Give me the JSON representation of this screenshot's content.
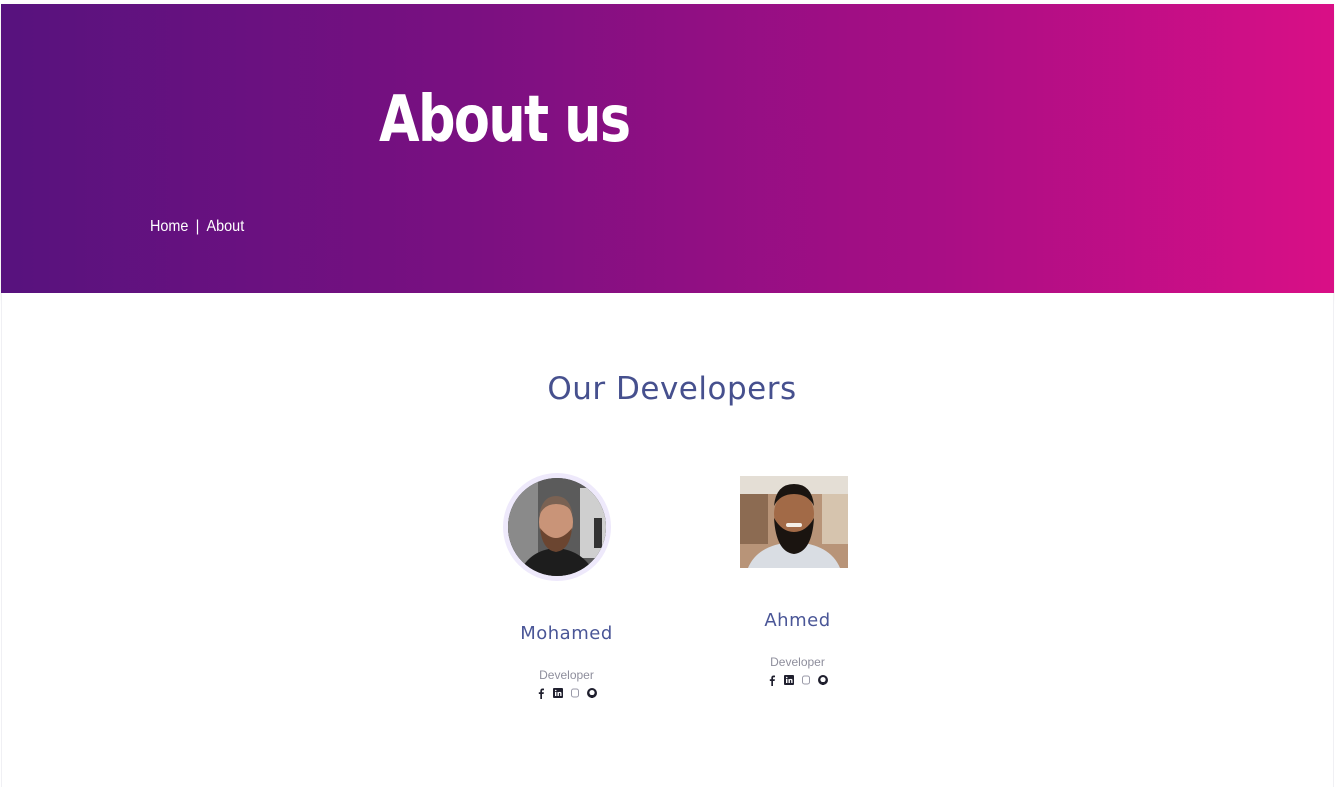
{
  "hero": {
    "title": "About us",
    "breadcrumb": {
      "home": "Home",
      "separator": "|",
      "current": "About"
    },
    "gradient": [
      "#57127e",
      "#d90f86"
    ]
  },
  "developers": {
    "title": "Our Developers",
    "members": [
      {
        "name": "Mohamed",
        "role": "Developer",
        "socials": [
          "facebook-icon",
          "linkedin-icon",
          "instagram-icon",
          "github-icon"
        ]
      },
      {
        "name": "Ahmed",
        "role": "Developer",
        "socials": [
          "facebook-icon",
          "linkedin-icon",
          "instagram-icon",
          "github-icon"
        ]
      }
    ]
  },
  "colors": {
    "accent": "#46508e",
    "icon": "#1f1f2e"
  }
}
